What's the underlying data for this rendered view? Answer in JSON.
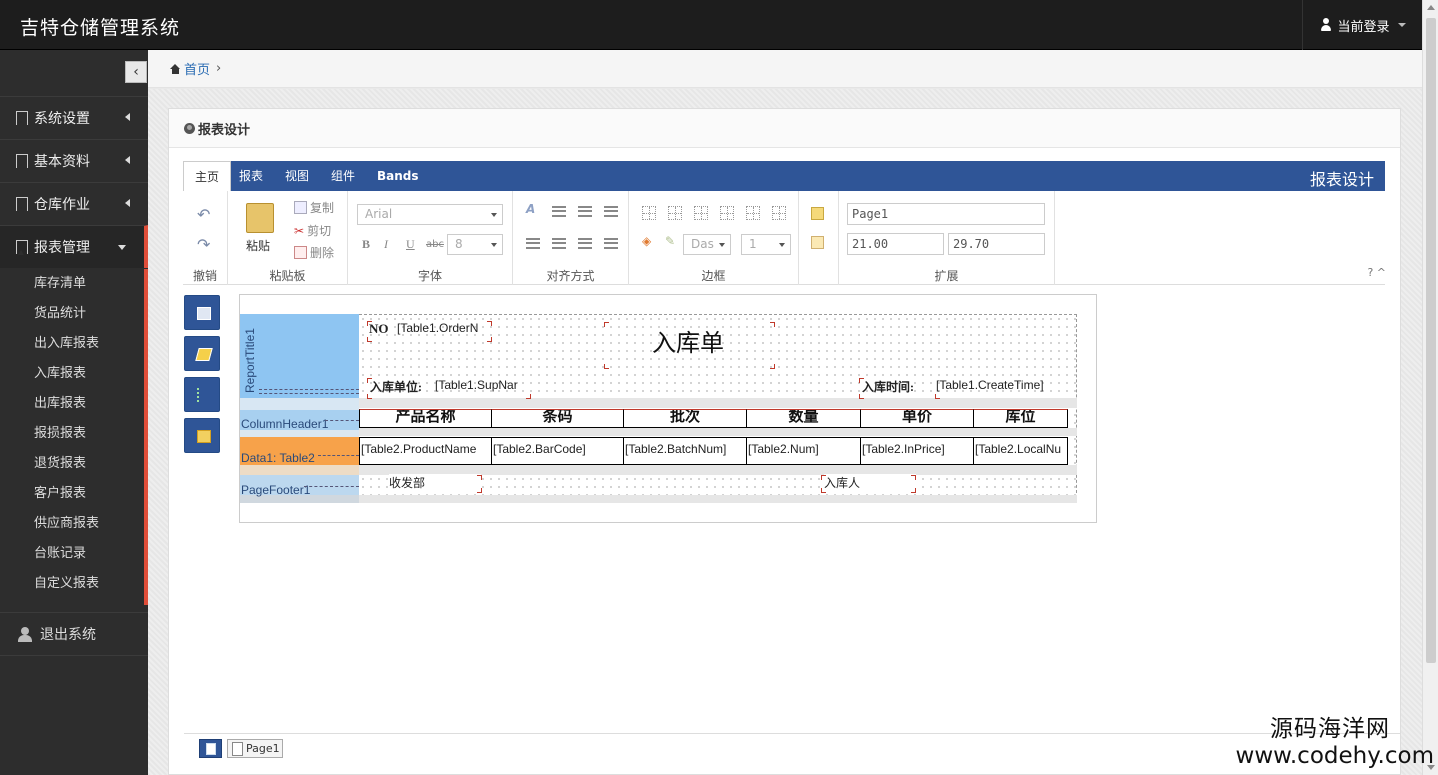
{
  "app": {
    "title": "吉特仓储管理系统",
    "user_menu": "当前登录"
  },
  "sidebar": {
    "toggle": "‹",
    "items": [
      {
        "label": "系统设置"
      },
      {
        "label": "基本资料"
      },
      {
        "label": "仓库作业"
      },
      {
        "label": "报表管理"
      }
    ],
    "submenu": [
      "库存清单",
      "货品统计",
      "出入库报表",
      "入库报表",
      "出库报表",
      "报损报表",
      "退货报表",
      "客户报表",
      "供应商报表",
      "台账记录",
      "自定义报表"
    ],
    "logout": "退出系统"
  },
  "breadcrumb": {
    "home": "首页",
    "sep": "›"
  },
  "panel": {
    "title": "报表设计"
  },
  "ribbon": {
    "tabs": [
      "主页",
      "报表",
      "视图",
      "组件",
      "Bands"
    ],
    "title": "报表设计",
    "groups": {
      "undo": "撤销",
      "clipboard": "粘贴板",
      "font": "字体",
      "align": "对齐方式",
      "border": "边框",
      "extend": "扩展"
    },
    "paste": "粘贴",
    "copy": "复制",
    "cut": "剪切",
    "delete": "删除",
    "font_name": "Arial",
    "font_size": "8",
    "bold": "B",
    "italic": "I",
    "underline": "U",
    "strike": "abc",
    "border_style": "Das",
    "border_width": "1",
    "page_name": "Page1",
    "page_width": "21.00",
    "page_height": "29.70",
    "help": "?  ^"
  },
  "report": {
    "bands": {
      "report_title": "ReportTitle1",
      "column_header": "ColumnHeader1",
      "data": "Data1: Table2",
      "page_footer": "PageFooter1"
    },
    "title": "入库单",
    "no_label": "NO",
    "order_no": "[Table1.OrderN",
    "supplier_label": "入库单位:",
    "supplier": "[Table1.SupNar",
    "time_label": "入库时间:",
    "time": "[Table1.CreateTime]",
    "headers": [
      "产品名称",
      "条码",
      "批次",
      "数量",
      "单价",
      "库位"
    ],
    "cells": [
      "[Table2.ProductName",
      "[Table2.BarCode]",
      "[Table2.BatchNum]",
      "[Table2.Num]",
      "[Table2.InPrice]",
      "[Table2.LocalNu"
    ],
    "footer_left": "收发部",
    "footer_right": "入库人"
  },
  "pages": {
    "tab": "Page1"
  },
  "watermark": {
    "line1": "源码海洋网",
    "line2": "www.codehy.com"
  }
}
